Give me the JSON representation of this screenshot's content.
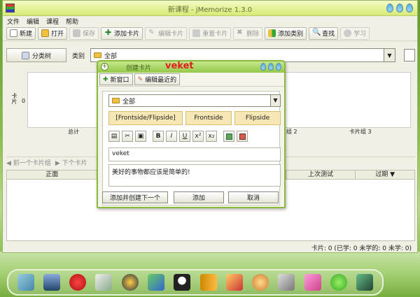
{
  "window": {
    "title": "新课程 - jMemorize 1.3.0"
  },
  "menu": [
    "文件",
    "编辑",
    "课程",
    "帮助"
  ],
  "toolbar": {
    "new": "新建",
    "open": "打开",
    "save": "保存",
    "add_card": "添加卡片",
    "edit_card": "编辑卡片",
    "reset_card": "重置卡片",
    "delete": "删除",
    "add_category": "添加类别",
    "find": "查找",
    "learn": "学习"
  },
  "category_row": {
    "split_view": "分类树",
    "label": "类别",
    "selected": "全部"
  },
  "chart": {
    "ylabel": "卡片",
    "ytick": "0",
    "xtick_total": "总计",
    "xtick_deck2_partial": "组 2",
    "xtick_deck3": "卡片组 3"
  },
  "nav": {
    "prev": "前一个卡片组",
    "next": "下个卡片"
  },
  "table": {
    "col_front": "正面",
    "col_last_test": "上次测试",
    "col_expire": "过期"
  },
  "status": {
    "text": "卡片: 0 (已学: 0 未学的: 0 未学: 0)"
  },
  "dialog": {
    "title": "创建卡片",
    "overlay_text": "veket",
    "btn_new_window": "新窗口",
    "btn_edit_recent": "编辑最近的",
    "category": "全部",
    "tab_frontside_flipside": "[Frontside/Flipside]",
    "tab_frontside": "Frontside",
    "tab_flipside": "Flipside",
    "front_value": "veket",
    "back_value": "美好的事物都应该是简单的!",
    "btn_add_next": "添加并创建下一个",
    "btn_add": "添加",
    "btn_cancel": "取消"
  },
  "colors": {
    "titlebar": "#e6f49a",
    "dialog_border": "#8ab93e",
    "tab_bg": "#f7e7b4",
    "overlay_red": "#e02020"
  },
  "dock_icons": [
    "image-viewer-icon",
    "monitor-icon",
    "pets-icon",
    "notes-icon",
    "music-disc-icon",
    "network-icon",
    "penguin-icon",
    "book-icon",
    "office-icon",
    "paint-icon",
    "usb-drive-icon",
    "photo-icon",
    "plant-icon",
    "recorder-icon"
  ]
}
